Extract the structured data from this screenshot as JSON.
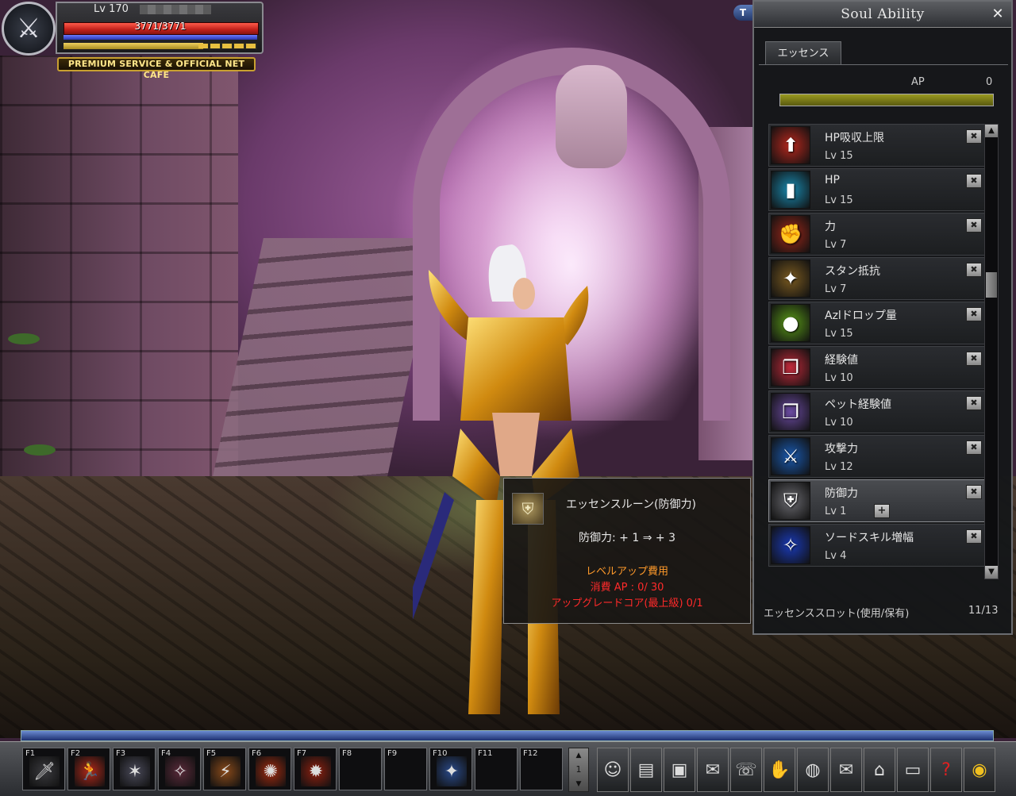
{
  "player": {
    "level": "Lv 170",
    "hp": "3771/3771",
    "premium": "PREMIUM SERVICE & OFFICIAL NET CAFE",
    "sp_fraction": 0.72,
    "class_icon": "sword-lightning-icon"
  },
  "top_button": "T",
  "soul_window": {
    "title": "Soul Ability",
    "close": "✕",
    "tab": "エッセンス",
    "ap_label": "AP",
    "ap_value": "0",
    "items": [
      {
        "name": "HP吸収上限",
        "level": "Lv 15",
        "icon": "hp-absorb-icon",
        "glyph": "⬆",
        "color": "#b8281e"
      },
      {
        "name": "HP",
        "level": "Lv 15",
        "icon": "hp-potion-icon",
        "glyph": "▮",
        "color": "#1a8ab0"
      },
      {
        "name": "力",
        "level": "Lv 7",
        "icon": "strength-icon",
        "glyph": "✊",
        "color": "#a0281a"
      },
      {
        "name": "スタン抵抗",
        "level": "Lv 7",
        "icon": "stun-resist-icon",
        "glyph": "✦",
        "color": "#7a5a20"
      },
      {
        "name": "Azlドロップ量",
        "level": "Lv 15",
        "icon": "gold-coins-icon",
        "glyph": "●",
        "color": "#5a9a18"
      },
      {
        "name": "経験値",
        "level": "Lv 10",
        "icon": "experience-book-icon",
        "glyph": "❐",
        "color": "#c02a3a"
      },
      {
        "name": "ペット経験値",
        "level": "Lv 10",
        "icon": "pet-experience-book-icon",
        "glyph": "❐",
        "color": "#6a4aa0"
      },
      {
        "name": "攻撃力",
        "level": "Lv 12",
        "icon": "attack-sword-icon",
        "glyph": "⚔",
        "color": "#1a5ab0"
      },
      {
        "name": "防御力",
        "level": "Lv 1",
        "icon": "defense-shield-icon",
        "glyph": "⛨",
        "color": "#6a6a70",
        "selected": true
      },
      {
        "name": "ソードスキル増幅",
        "level": "Lv 4",
        "icon": "sword-skill-icon",
        "glyph": "✧",
        "color": "#1a3ab8"
      }
    ],
    "remove_label": "✖",
    "plus_label": "+",
    "slot_label": "エッセンススロット(使用/保有)",
    "slot_value": "11/13"
  },
  "tooltip": {
    "title": "エッセンスルーン(防御力)",
    "stat": "防御力: + 1 ⇒ + 3",
    "cost_header": "レベルアップ費用",
    "cost_ap": "消費 AP : 0/ 30",
    "cost_core": "アップグレードコア(最上級) 0/1"
  },
  "hotbar": {
    "keys": [
      {
        "label": "F1",
        "icon": "sword-skill-slot-icon",
        "glyph": "🗡",
        "color": "#3a3a3e"
      },
      {
        "label": "F2",
        "icon": "dash-skill-icon",
        "glyph": "🏃",
        "color": "#b0281a"
      },
      {
        "label": "F3",
        "icon": "slash-skill-icon",
        "glyph": "✶",
        "color": "#4a4a5a"
      },
      {
        "label": "F4",
        "icon": "blade-skill-icon",
        "glyph": "✧",
        "color": "#5a2a3a"
      },
      {
        "label": "F5",
        "icon": "strike-skill-icon",
        "glyph": "⚡",
        "color": "#8a4a1a"
      },
      {
        "label": "F6",
        "icon": "fire-skill-icon",
        "glyph": "✺",
        "color": "#a02a10"
      },
      {
        "label": "F7",
        "icon": "whirl-skill-icon",
        "glyph": "✹",
        "color": "#902010"
      },
      {
        "label": "F8",
        "icon": "",
        "glyph": "",
        "color": "#0e0e10"
      },
      {
        "label": "F9",
        "icon": "",
        "glyph": "",
        "color": "#0e0e10"
      },
      {
        "label": "F10",
        "icon": "buff-skill-icon",
        "glyph": "✦",
        "color": "#2a4a8a"
      },
      {
        "label": "F11",
        "icon": "",
        "glyph": "",
        "color": "#0e0e10"
      },
      {
        "label": "F12",
        "icon": "",
        "glyph": "",
        "color": "#0e0e10"
      }
    ],
    "page": "1"
  },
  "menu": [
    {
      "name": "character-portrait-icon",
      "glyph": "☺"
    },
    {
      "name": "skill-book-icon",
      "glyph": "▤"
    },
    {
      "name": "inventory-chest-icon",
      "glyph": "▣"
    },
    {
      "name": "quest-scroll-icon",
      "glyph": "✉"
    },
    {
      "name": "chat-icon",
      "glyph": "☏"
    },
    {
      "name": "handshake-icon",
      "glyph": "✋"
    },
    {
      "name": "world-globe-icon",
      "glyph": "◍"
    },
    {
      "name": "mail-icon",
      "glyph": "✉"
    },
    {
      "name": "shop-icon",
      "glyph": "⌂"
    },
    {
      "name": "system-monitor-icon",
      "glyph": "▭"
    },
    {
      "name": "help-icon",
      "glyph": "?"
    },
    {
      "name": "coin-icon",
      "glyph": "◉"
    }
  ]
}
